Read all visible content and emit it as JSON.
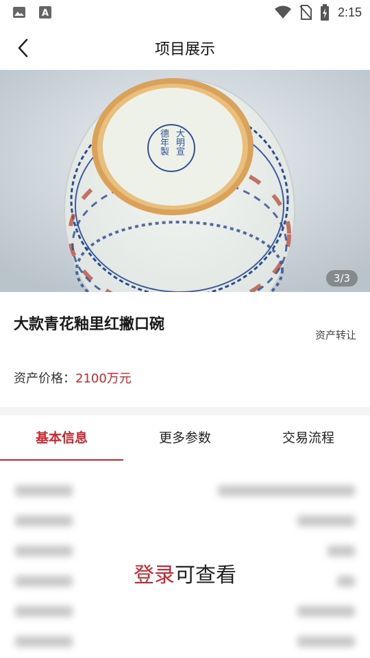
{
  "status_bar": {
    "time": "2:15",
    "icons": [
      "image-icon",
      "font-icon",
      "wifi-icon",
      "no-sim-icon",
      "battery-charging-icon"
    ]
  },
  "header": {
    "title": "项目展示",
    "back_icon": "chevron-left-icon"
  },
  "gallery": {
    "counter": "3/3",
    "mark_lines": [
      "大明宣",
      "德年製"
    ]
  },
  "item": {
    "title": "大款青花釉里红撇口碗",
    "tag": "资产转让",
    "price_label": "资产价格：",
    "price_value": "2100万元"
  },
  "tabs": [
    {
      "label": "基本信息",
      "active": true
    },
    {
      "label": "更多参数",
      "active": false
    },
    {
      "label": "交易流程",
      "active": false
    }
  ],
  "login_prompt": {
    "link": "登录",
    "rest": "可查看"
  },
  "colors": {
    "accent": "#d0232c",
    "separator": "#f4f4f4"
  }
}
